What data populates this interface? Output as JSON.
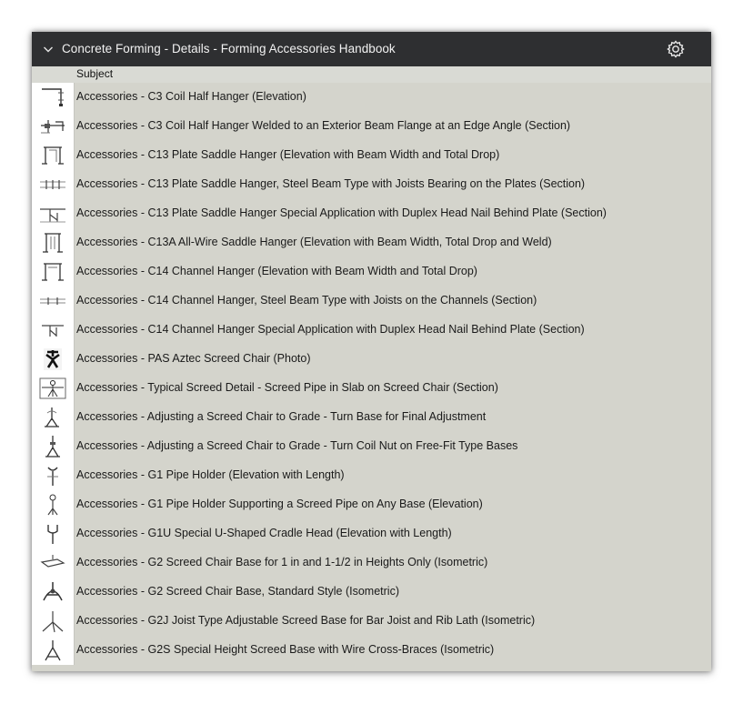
{
  "panel": {
    "title": "Concrete Forming - Details - Forming Accessories Handbook",
    "collapse_icon": "chevron-down-icon",
    "settings_icon": "gear-icon",
    "column_header": "Subject"
  },
  "rows": [
    {
      "subject": "Accessories - C3 Coil Half Hanger (Elevation)",
      "icon": "hanger-drawing-thumbnail"
    },
    {
      "subject": "Accessories - C3 Coil Half Hanger Welded to an Exterior Beam Flange at an Edge Angle (Section)",
      "icon": "section-drawing-thumbnail"
    },
    {
      "subject": "Accessories - C13 Plate Saddle Hanger (Elevation with Beam Width and Total Drop)",
      "icon": "saddle-hanger-thumbnail"
    },
    {
      "subject": "Accessories - C13 Plate Saddle Hanger, Steel Beam Type with Joists Bearing on the Plates (Section)",
      "icon": "section-drawing-thumbnail"
    },
    {
      "subject": "Accessories - C13 Plate Saddle Hanger Special Application with Duplex Head Nail Behind Plate (Section)",
      "icon": "section-drawing-thumbnail"
    },
    {
      "subject": "Accessories - C13A All-Wire Saddle Hanger (Elevation with Beam Width, Total Drop and Weld)",
      "icon": "saddle-hanger-thumbnail"
    },
    {
      "subject": "Accessories - C14 Channel Hanger (Elevation with Beam Width and Total Drop)",
      "icon": "saddle-hanger-thumbnail"
    },
    {
      "subject": "Accessories - C14 Channel Hanger, Steel Beam Type with Joists on the Channels (Section)",
      "icon": "section-drawing-thumbnail"
    },
    {
      "subject": "Accessories - C14 Channel Hanger Special Application with Duplex Head Nail Behind Plate (Section)",
      "icon": "section-drawing-thumbnail"
    },
    {
      "subject": "Accessories - PAS Aztec Screed Chair (Photo)",
      "icon": "screed-chair-photo-thumbnail"
    },
    {
      "subject": "Accessories - Typical Screed Detail - Screed Pipe in Slab on Screed Chair (Section)",
      "icon": "screed-detail-thumbnail"
    },
    {
      "subject": "Accessories - Adjusting a Screed Chair to Grade - Turn Base for Final Adjustment",
      "icon": "screed-chair-thumbnail"
    },
    {
      "subject": "Accessories - Adjusting a Screed Chair to Grade - Turn Coil Nut on Free-Fit Type Bases",
      "icon": "screed-chair-thumbnail"
    },
    {
      "subject": "Accessories - G1 Pipe Holder (Elevation with Length)",
      "icon": "pipe-holder-thumbnail"
    },
    {
      "subject": "Accessories - G1 Pipe Holder Supporting a Screed Pipe on Any Base (Elevation)",
      "icon": "pipe-holder-thumbnail"
    },
    {
      "subject": "Accessories - G1U Special U-Shaped Cradle Head (Elevation with Length)",
      "icon": "pipe-holder-thumbnail"
    },
    {
      "subject": "Accessories - G2 Screed Chair Base for 1 in and 1-1/2 in Heights Only (Isometric)",
      "icon": "chair-base-thumbnail"
    },
    {
      "subject": "Accessories - G2 Screed Chair Base, Standard Style (Isometric)",
      "icon": "chair-base-thumbnail"
    },
    {
      "subject": "Accessories - G2J Joist Type Adjustable Screed Base for Bar Joist and Rib Lath (Isometric)",
      "icon": "tripod-base-thumbnail"
    },
    {
      "subject": "Accessories - G2S Special Height Screed Base with Wire Cross-Braces (Isometric)",
      "icon": "tripod-base-thumbnail"
    }
  ]
}
